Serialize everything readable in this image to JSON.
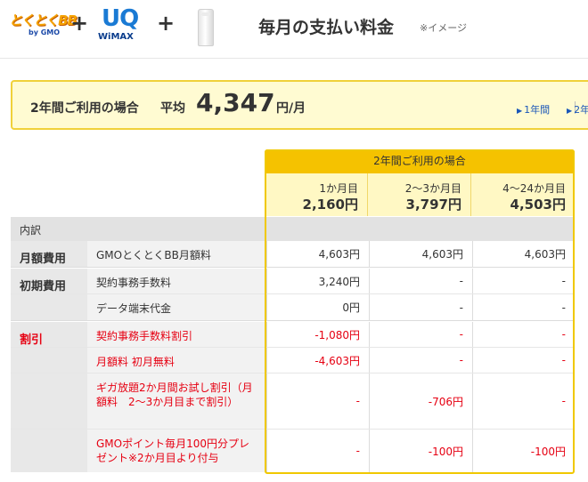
{
  "header": {
    "logo1_text": "とくとくBB",
    "logo1_sub": "by GMO",
    "plus1": "+",
    "logo2_text": "UQ",
    "logo2_sub": "WiMAX",
    "plus2": "+",
    "title": "毎月の支払い料金",
    "note": "※イメージ"
  },
  "summary": {
    "label": "2年間ご利用の場合",
    "avg_label": "平均",
    "amount": "4,347",
    "unit": "円/月",
    "tabs": [
      {
        "label": "1年間"
      },
      {
        "label": "2年"
      }
    ]
  },
  "table": {
    "column_group": "2年間ご利用の場合",
    "columns": [
      {
        "month": "1か月目",
        "total": "2,160円"
      },
      {
        "month": "2〜3か月目",
        "total": "3,797円"
      },
      {
        "month": "4〜24か月目",
        "total": "4,503円"
      }
    ],
    "breakdown_label": "内訳",
    "rows": [
      {
        "category": "月額費用",
        "item": "GMOとくとくBB月額料",
        "v1": "4,603円",
        "v2": "4,603円",
        "v3": "4,603円"
      },
      {
        "category": "初期費用",
        "item": "契約事務手数料",
        "v1": "3,240円",
        "v2": "-",
        "v3": "-"
      },
      {
        "category": "",
        "item": "データ端末代金",
        "v1": "0円",
        "v2": "-",
        "v3": "-"
      },
      {
        "category": "割引",
        "item": "契約事務手数料割引",
        "v1": "-1,080円",
        "v2": "-",
        "v3": "-"
      },
      {
        "category": "",
        "item": "月額料 初月無料",
        "v1": "-4,603円",
        "v2": "-",
        "v3": "-"
      },
      {
        "category": "",
        "item": "ギガ放題2か月間お試し割引（月額料　2〜3か月目まで割引）",
        "v1": "-",
        "v2": "-706円",
        "v3": "-"
      },
      {
        "category": "",
        "item": "GMOポイント毎月100円分プレゼント※2か月目より付与",
        "v1": "-",
        "v2": "-100円",
        "v3": "-100円"
      }
    ]
  },
  "colors": {
    "accent_yellow": "#f5c200",
    "summary_bg": "#fffbd2",
    "discount_red": "#e60012",
    "link_blue": "#1a56b8"
  }
}
